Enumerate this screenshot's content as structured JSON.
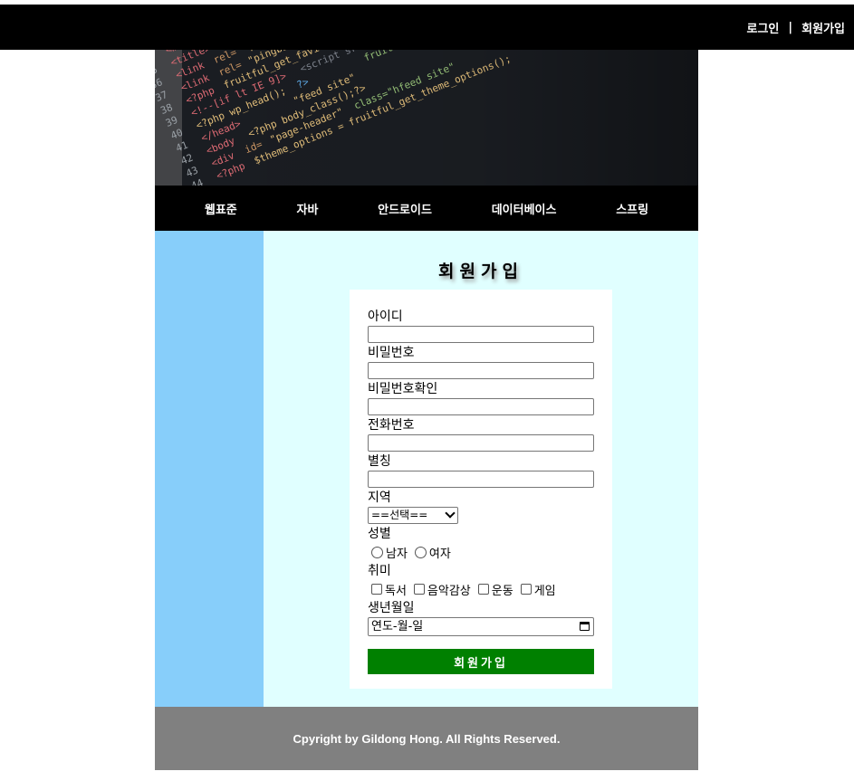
{
  "topbar": {
    "login": "로그인",
    "separator": "|",
    "signup": "회원가입"
  },
  "nav": {
    "items": [
      "웹표준",
      "자바",
      "안드로이드",
      "데이터베이스",
      "스프링"
    ]
  },
  "main": {
    "title": "회원가입"
  },
  "form": {
    "id_label": "아이디",
    "password_label": "비밀번호",
    "password_confirm_label": "비밀번호확인",
    "phone_label": "전화번호",
    "nickname_label": "별칭",
    "region_label": "지역",
    "region_selected": "==선택==",
    "gender_label": "성별",
    "gender_options": [
      "남자",
      "여자"
    ],
    "hobby_label": "취미",
    "hobby_options": [
      "독서",
      "음악감상",
      "운동",
      "게임"
    ],
    "birthdate_label": "생년월일",
    "birthdate_placeholder": "연도-월-일",
    "submit_label": "회원가입"
  },
  "footer": {
    "copyright": "Cpyright by Gildong Hong. All Rights Reserved."
  },
  "colors": {
    "topbar_bg": "#000000",
    "nav_bg": "#000000",
    "side_bg": "#87cefa",
    "main_bg": "#e0ffff",
    "submit_bg": "#008000",
    "footer_bg": "#808080"
  },
  "banner": {
    "image": "code-editor-photo"
  }
}
